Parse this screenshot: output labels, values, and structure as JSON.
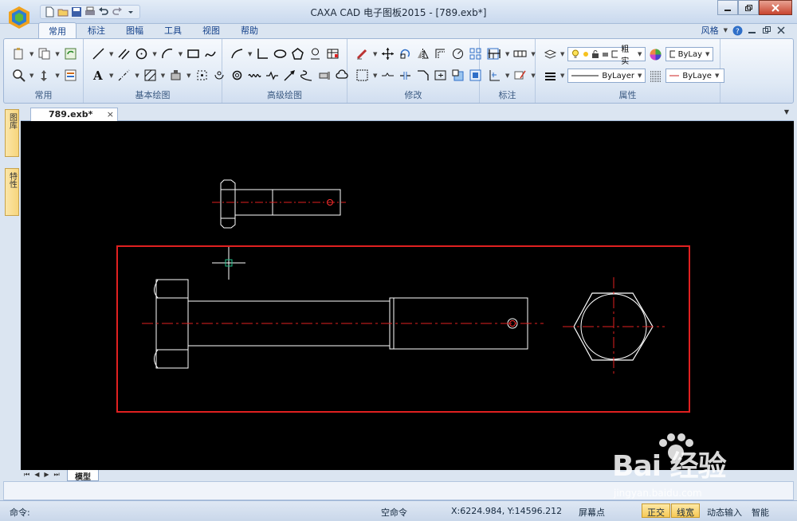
{
  "window": {
    "title": "CAXA CAD 电子图板2015 - [789.exb*]",
    "controls": [
      "minimize",
      "restore",
      "close"
    ]
  },
  "ribbon_tabs": [
    {
      "label": "常用",
      "active": true
    },
    {
      "label": "标注",
      "active": false
    },
    {
      "label": "图幅",
      "active": false
    },
    {
      "label": "工具",
      "active": false
    },
    {
      "label": "视图",
      "active": false
    },
    {
      "label": "帮助",
      "active": false
    }
  ],
  "tabs_right": {
    "style_label": "风格"
  },
  "ribbon_groups": [
    "常用",
    "基本绘图",
    "高级绘图",
    "修改",
    "标注",
    "属性"
  ],
  "properties": {
    "layer_name": "粗实",
    "color_value": "ByLay",
    "linetype_value": "ByLayer",
    "lineweight_value": "ByLaye"
  },
  "side_tabs": [
    "图库",
    "特性"
  ],
  "document_tab": {
    "label": "789.exb*",
    "close": "×"
  },
  "layout_tab": {
    "label": "模型"
  },
  "status": {
    "command_label": "命令:",
    "command_state": "空命令",
    "coordinates": "X:6224.984, Y:14596.212",
    "snap_mode": "屏幕点",
    "ortho": "正交",
    "lineweight": "线宽",
    "dynamic_input": "动态输入",
    "smart": "智能"
  },
  "watermark": {
    "text": "Bai 经验",
    "url": "jingyan.baidu.com"
  },
  "colors": {
    "canvas": "#000000",
    "highlight_box": "#e02020",
    "centerline": "#e02020",
    "geometry": "#ffffff",
    "cursor": "#ffffff",
    "cursor_box": "#22c08a"
  }
}
